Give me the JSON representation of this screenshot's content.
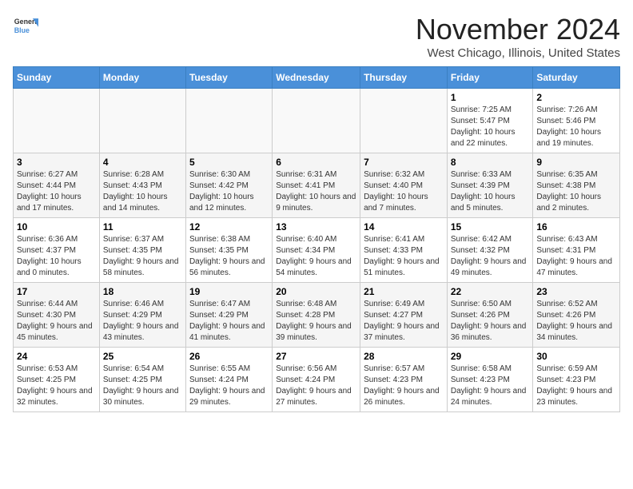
{
  "logo": {
    "general": "General",
    "blue": "Blue"
  },
  "header": {
    "month": "November 2024",
    "location": "West Chicago, Illinois, United States"
  },
  "weekdays": [
    "Sunday",
    "Monday",
    "Tuesday",
    "Wednesday",
    "Thursday",
    "Friday",
    "Saturday"
  ],
  "weeks": [
    [
      {
        "day": "",
        "info": ""
      },
      {
        "day": "",
        "info": ""
      },
      {
        "day": "",
        "info": ""
      },
      {
        "day": "",
        "info": ""
      },
      {
        "day": "",
        "info": ""
      },
      {
        "day": "1",
        "info": "Sunrise: 7:25 AM\nSunset: 5:47 PM\nDaylight: 10 hours and 22 minutes."
      },
      {
        "day": "2",
        "info": "Sunrise: 7:26 AM\nSunset: 5:46 PM\nDaylight: 10 hours and 19 minutes."
      }
    ],
    [
      {
        "day": "3",
        "info": "Sunrise: 6:27 AM\nSunset: 4:44 PM\nDaylight: 10 hours and 17 minutes."
      },
      {
        "day": "4",
        "info": "Sunrise: 6:28 AM\nSunset: 4:43 PM\nDaylight: 10 hours and 14 minutes."
      },
      {
        "day": "5",
        "info": "Sunrise: 6:30 AM\nSunset: 4:42 PM\nDaylight: 10 hours and 12 minutes."
      },
      {
        "day": "6",
        "info": "Sunrise: 6:31 AM\nSunset: 4:41 PM\nDaylight: 10 hours and 9 minutes."
      },
      {
        "day": "7",
        "info": "Sunrise: 6:32 AM\nSunset: 4:40 PM\nDaylight: 10 hours and 7 minutes."
      },
      {
        "day": "8",
        "info": "Sunrise: 6:33 AM\nSunset: 4:39 PM\nDaylight: 10 hours and 5 minutes."
      },
      {
        "day": "9",
        "info": "Sunrise: 6:35 AM\nSunset: 4:38 PM\nDaylight: 10 hours and 2 minutes."
      }
    ],
    [
      {
        "day": "10",
        "info": "Sunrise: 6:36 AM\nSunset: 4:37 PM\nDaylight: 10 hours and 0 minutes."
      },
      {
        "day": "11",
        "info": "Sunrise: 6:37 AM\nSunset: 4:35 PM\nDaylight: 9 hours and 58 minutes."
      },
      {
        "day": "12",
        "info": "Sunrise: 6:38 AM\nSunset: 4:35 PM\nDaylight: 9 hours and 56 minutes."
      },
      {
        "day": "13",
        "info": "Sunrise: 6:40 AM\nSunset: 4:34 PM\nDaylight: 9 hours and 54 minutes."
      },
      {
        "day": "14",
        "info": "Sunrise: 6:41 AM\nSunset: 4:33 PM\nDaylight: 9 hours and 51 minutes."
      },
      {
        "day": "15",
        "info": "Sunrise: 6:42 AM\nSunset: 4:32 PM\nDaylight: 9 hours and 49 minutes."
      },
      {
        "day": "16",
        "info": "Sunrise: 6:43 AM\nSunset: 4:31 PM\nDaylight: 9 hours and 47 minutes."
      }
    ],
    [
      {
        "day": "17",
        "info": "Sunrise: 6:44 AM\nSunset: 4:30 PM\nDaylight: 9 hours and 45 minutes."
      },
      {
        "day": "18",
        "info": "Sunrise: 6:46 AM\nSunset: 4:29 PM\nDaylight: 9 hours and 43 minutes."
      },
      {
        "day": "19",
        "info": "Sunrise: 6:47 AM\nSunset: 4:29 PM\nDaylight: 9 hours and 41 minutes."
      },
      {
        "day": "20",
        "info": "Sunrise: 6:48 AM\nSunset: 4:28 PM\nDaylight: 9 hours and 39 minutes."
      },
      {
        "day": "21",
        "info": "Sunrise: 6:49 AM\nSunset: 4:27 PM\nDaylight: 9 hours and 37 minutes."
      },
      {
        "day": "22",
        "info": "Sunrise: 6:50 AM\nSunset: 4:26 PM\nDaylight: 9 hours and 36 minutes."
      },
      {
        "day": "23",
        "info": "Sunrise: 6:52 AM\nSunset: 4:26 PM\nDaylight: 9 hours and 34 minutes."
      }
    ],
    [
      {
        "day": "24",
        "info": "Sunrise: 6:53 AM\nSunset: 4:25 PM\nDaylight: 9 hours and 32 minutes."
      },
      {
        "day": "25",
        "info": "Sunrise: 6:54 AM\nSunset: 4:25 PM\nDaylight: 9 hours and 30 minutes."
      },
      {
        "day": "26",
        "info": "Sunrise: 6:55 AM\nSunset: 4:24 PM\nDaylight: 9 hours and 29 minutes."
      },
      {
        "day": "27",
        "info": "Sunrise: 6:56 AM\nSunset: 4:24 PM\nDaylight: 9 hours and 27 minutes."
      },
      {
        "day": "28",
        "info": "Sunrise: 6:57 AM\nSunset: 4:23 PM\nDaylight: 9 hours and 26 minutes."
      },
      {
        "day": "29",
        "info": "Sunrise: 6:58 AM\nSunset: 4:23 PM\nDaylight: 9 hours and 24 minutes."
      },
      {
        "day": "30",
        "info": "Sunrise: 6:59 AM\nSunset: 4:23 PM\nDaylight: 9 hours and 23 minutes."
      }
    ]
  ]
}
